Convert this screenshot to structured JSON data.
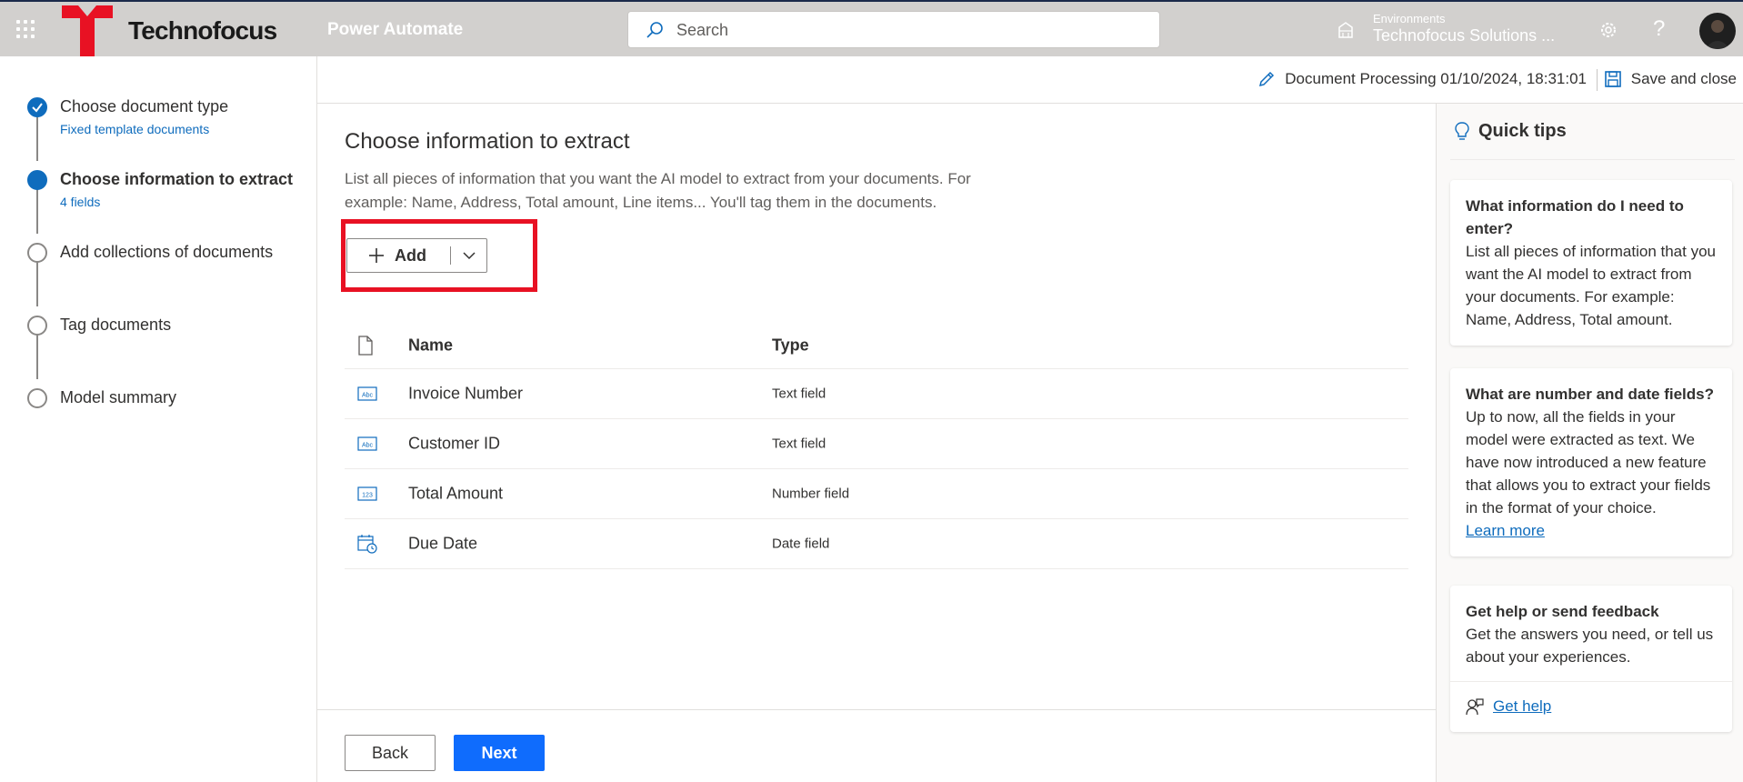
{
  "header": {
    "brand": "Technofocus",
    "app_name": "Power Automate",
    "search_placeholder": "Search",
    "env_label": "Environments",
    "env_name": "Technofocus Solutions ..."
  },
  "steps": [
    {
      "title": "Choose document type",
      "subtitle": "Fixed template documents",
      "state": "done"
    },
    {
      "title": "Choose information to extract",
      "subtitle": "4 fields",
      "state": "current"
    },
    {
      "title": "Add collections of documents",
      "subtitle": "",
      "state": "pending"
    },
    {
      "title": "Tag documents",
      "subtitle": "",
      "state": "pending"
    },
    {
      "title": "Model summary",
      "subtitle": "",
      "state": "pending"
    }
  ],
  "commandbar": {
    "doc_title": "Document Processing 01/10/2024, 18:31:01",
    "save_close": "Save and close"
  },
  "main": {
    "title": "Choose information to extract",
    "description": "List all pieces of information that you want the AI model to extract from your documents. For example: Name, Address, Total amount, Line items... You'll tag them in the documents.",
    "add_label": "Add",
    "table": {
      "headers": {
        "name": "Name",
        "type": "Type"
      },
      "rows": [
        {
          "name": "Invoice Number",
          "type": "Text field",
          "icon": "text-field-icon"
        },
        {
          "name": "Customer ID",
          "type": "Text field",
          "icon": "text-field-icon"
        },
        {
          "name": "Total Amount",
          "type": "Number field",
          "icon": "number-field-icon"
        },
        {
          "name": "Due Date",
          "type": "Date field",
          "icon": "date-field-icon"
        }
      ]
    }
  },
  "footer": {
    "back": "Back",
    "next": "Next"
  },
  "quick_tips": {
    "title": "Quick tips",
    "cards": [
      {
        "title": "What information do I need to enter?",
        "body": "List all pieces of information that you want the AI model to extract from your documents. For example: Name, Address, Total amount."
      },
      {
        "title": "What are number and date fields?",
        "body": "Up to now, all the fields in your model were extracted as text. We have now introduced a new feature that allows you to extract your fields in the format of your choice.",
        "link": "Learn more"
      },
      {
        "title": "Get help or send feedback",
        "body": "Get the answers you need, or tell us about your experiences.",
        "link": "Get help"
      }
    ]
  },
  "colors": {
    "accent": "#0f6cbd",
    "primary_button": "#0f6cfd",
    "highlight": "#e81123",
    "logo_red": "#e81123",
    "topbar": "#d2d0ce"
  }
}
